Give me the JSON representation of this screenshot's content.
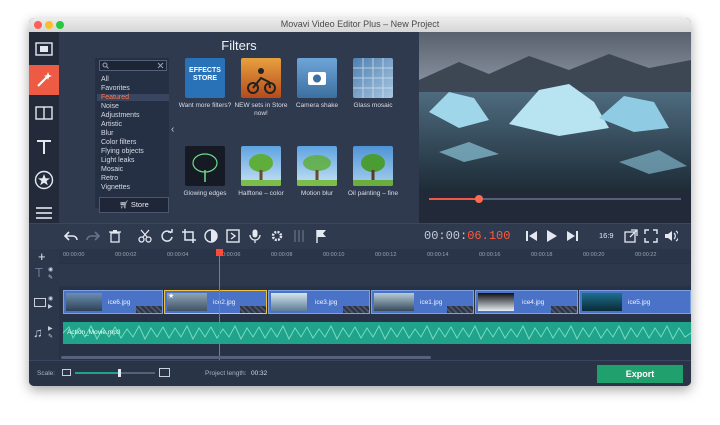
{
  "window": {
    "title": "Movavi Video Editor Plus – New Project"
  },
  "filters_panel": {
    "title": "Filters",
    "search": {
      "value": "",
      "placeholder": ""
    },
    "categories": [
      "All",
      "Favorites",
      "Featured",
      "Noise",
      "Adjustments",
      "Artistic",
      "Blur",
      "Color filters",
      "Flying objects",
      "Light leaks",
      "Mosaic",
      "Retro",
      "Vignettes"
    ],
    "selected_category": "Featured",
    "store_button": "Store",
    "filters": [
      {
        "label": "Want more filters?",
        "thumb": "EFFECTS STORE"
      },
      {
        "label": "NEW sets in Store now!"
      },
      {
        "label": "Camera shake"
      },
      {
        "label": "Glass mosaic"
      },
      {
        "label": "Glowing edges"
      },
      {
        "label": "Halftone – color"
      },
      {
        "label": "Motion blur"
      },
      {
        "label": "Oil painting – fine"
      }
    ]
  },
  "toolbar": {
    "timecode_prefix": "00:00:",
    "timecode_active": "06.100",
    "aspect": "16:9"
  },
  "timeline": {
    "ticks": [
      "00:00:00",
      "00:00:02",
      "00:00:04",
      "00:00:06",
      "00:00:08",
      "00:00:10",
      "00:00:12",
      "00:00:14",
      "00:00:16",
      "00:00:18",
      "00:00:20",
      "00:00:22"
    ],
    "clips": [
      "ice6.jpg",
      "ice2.jpg",
      "ice3.jpg",
      "ice1.jpg",
      "ice4.jpg",
      "ice5.jpg"
    ],
    "audio_track": "Action_Movie.mp3"
  },
  "bottom_bar": {
    "scale_label": "Scale:",
    "zoom_level": 0.55,
    "project_length_label": "Project length:",
    "project_length": "00:32",
    "export_button": "Export"
  },
  "preview": {
    "progress": 0.2
  },
  "colors": {
    "accent": "#ee5b45",
    "timecode_red": "#ff5a3a",
    "export": "#20a06c",
    "clip": "#4a73c8",
    "audio": "#1fa38a"
  }
}
